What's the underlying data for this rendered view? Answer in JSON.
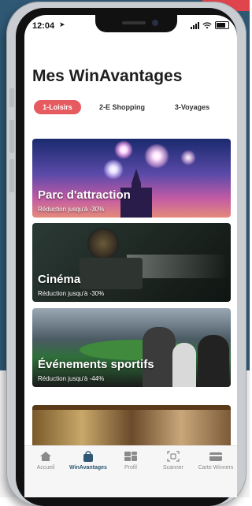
{
  "status_bar": {
    "time": "12:04"
  },
  "page": {
    "title": "Mes WinAvantages"
  },
  "tabs": [
    {
      "label": "1-Loisirs",
      "active": true
    },
    {
      "label": "2-E Shopping",
      "active": false
    },
    {
      "label": "3-Voyages",
      "active": false
    }
  ],
  "cards": [
    {
      "title": "Parc d'attraction",
      "subtitle": "Réduction jusqu'à -30%"
    },
    {
      "title": "Cinéma",
      "subtitle": "Réduction jusqu'à -30%"
    },
    {
      "title": "Événements sportifs",
      "subtitle": "Réduction jusqu'à -44%"
    },
    {
      "title": "",
      "subtitle": ""
    }
  ],
  "tabbar": [
    {
      "label": "Accueil",
      "icon": "home-icon",
      "active": false
    },
    {
      "label": "WinAvantages",
      "icon": "bag-icon",
      "active": true
    },
    {
      "label": "Profil",
      "icon": "profile-icon",
      "active": false
    },
    {
      "label": "Scanner",
      "icon": "scan-icon",
      "active": false
    },
    {
      "label": "Carte Winners",
      "icon": "card-icon",
      "active": false
    }
  ],
  "colors": {
    "accent": "#e65b5f",
    "brand": "#2f5874",
    "active_tabbar": "#2f5874"
  }
}
